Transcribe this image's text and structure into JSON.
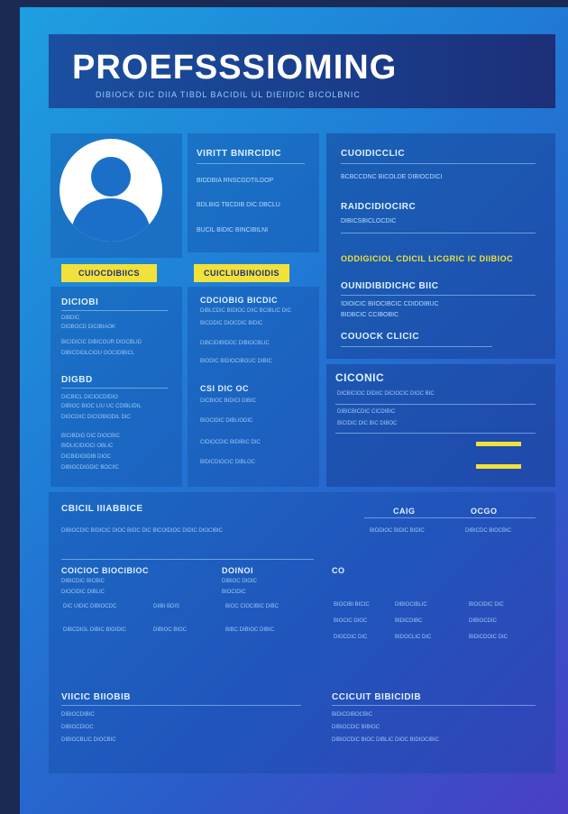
{
  "header": {
    "title": "PROEFSSSIOMING",
    "subtitle": "DIBIOCK DIC DIIA TIBDL BACIDIL UL DIEIIDIC BICOLBNIC"
  },
  "profile": {
    "button_left": "CUIOCDIBIICS",
    "button_right": "CUICLIUBINOIDIS"
  },
  "info_column": {
    "heading": "VIRITT BNIRCIDIC",
    "rows": [
      "BIDDBIA  RNSCGDTILDOP",
      "BDLBIG  TBCDIB DIC DBCLU",
      "BUCIL  BIDIC BINCIBILNI"
    ]
  },
  "right_top": {
    "heading_1": "CUOIDICCLIC",
    "line_1": "BCBCCDNC BICOLDE DIBIOCDICI",
    "heading_2": "RAIDCIDIOCIRC",
    "line_2": "DIBICSBICLOCDIC",
    "yellow_line": "ODDIGICIOL CDICIL LICGRIC IC DIIBIOC",
    "heading_3": "OUNIDIBIDICHC BIIC",
    "line_3a": "IDIDICIC BIIOCIBCIC CDIDDIBUC",
    "line_3b": "BIDBCIC CCIBOBIC",
    "heading_4": "COUOCK CLICIC"
  },
  "left_lower": {
    "heading_1": "DICIOBI",
    "lines_1": [
      "DIBDIC",
      "DIOBOCD DICIBIAOK",
      "BICIDICIC DIBICOUR DIOCBLID",
      "DIBICDIOLCIOU OOCIDIBICL"
    ],
    "heading_2": "DIGBD",
    "lines_2": [
      "DICBICL DICIOCDIDIO",
      "DIBIOC BIOC LIU UC CDIBLIDIL",
      "DIOCDIIC DICIOBIODIL DIC"
    ],
    "lines_3": [
      "BICIBDIG DIC DIOCBIC",
      "BIDLICIDIOCI OBLIC",
      "DICBIDIOIDIB DIOC",
      "DIBIOCDIGDIC BOCIIC"
    ]
  },
  "mid_lower": {
    "heading_1": "CDCIOBIG BICDIC",
    "lines_1": [
      "DIBLCDIC BIDIOC DIIC BCIBLIC DIC",
      "BICDDIC DIOCDIC BIDIC",
      "DIBCIDIBIDOC DIBIOCBLIC",
      "BIODIC BIDIOCIBOUC DIBIC"
    ],
    "heading_2": "CSI DIC OC",
    "lines_2": [
      "DICBIOC BIDICI DIBIC",
      "BIOCIDIC DIBLIODIC",
      "CIDIOCDIC BIDIBIC DIC",
      "BIDICDIOCIC DIBLOC"
    ]
  },
  "ciconic": {
    "heading": "CICONIC",
    "lines": [
      "DICBICIOC DIDIIC DICIOCIC DIOC BIC",
      "DIBICBICDIC CICDIBIC",
      "BICIDIC DIC BIC DIBOC"
    ],
    "bar_1": 0.6,
    "bar_2": 0.6
  },
  "bottom": {
    "heading_left": "CBICIL IIIABBICE",
    "line_left": "DIBIOCDIC BIDICIC DIOC BIOC DIC BICOIDIOC DIDIC DIOCIBIC",
    "heading_right_1": "CAIG",
    "heading_right_2": "OCGO",
    "line_right_1": "BIODIOC BIDIC BIDIC",
    "line_right_2": "DIBICDC BIOCBIC",
    "sub_1_heading": "COICIOC BIOCIBIOC",
    "sub_1_lines": [
      "DIBICDIC BICBIC",
      "DIOCIDIC DIBLIC"
    ],
    "sub_2_heading": "DOINOI",
    "sub_2_lines": [
      "DIBIOC DIOIC",
      "BIOCIDIC"
    ],
    "sub_3_heading": "CO",
    "row_a": [
      "DIC UIDIC DIBIOCDC",
      "DIIBI BDIS",
      "BIOC CIOCIBIC DIBC"
    ],
    "row_b": [
      "DIBCDIGL DIBIC BIGIDIC",
      "DIBIOC BIOC",
      "BIBC DIBIOC DIBIC"
    ],
    "grid": [
      [
        "BIOCIBI BICIC",
        "DIBIOCIBLIC",
        "BIOCIDIC DIC"
      ],
      [
        "BIOCIC DIOC",
        "BIDICDIBC",
        "DIBIOCDIC"
      ],
      [
        "DIOCDIC DIC",
        "BIDOCLIC DIC",
        "BIDICDOIC DIC"
      ]
    ],
    "foot_left_heading": "VIICIC BIIOBIB",
    "foot_left_lines": [
      "DIBIOCDIBIC",
      "DIBIOCDIOC",
      "DIBIOCBLIC DIOCBIC"
    ],
    "foot_right_heading": "CCICUIT BIBICIDIB",
    "foot_right_lines": [
      "BIDICDIBOCBIC",
      "DIBIOCDIC BIBIOC",
      "DIBIOCDIC BIOC DIBLIC DIOC BIDIOCIBIC"
    ]
  },
  "colors": {
    "accent": "#f2e13a",
    "header_bg": "#1b4fa0",
    "page_start": "#1e9fe0",
    "page_end": "#4b3fc4"
  }
}
